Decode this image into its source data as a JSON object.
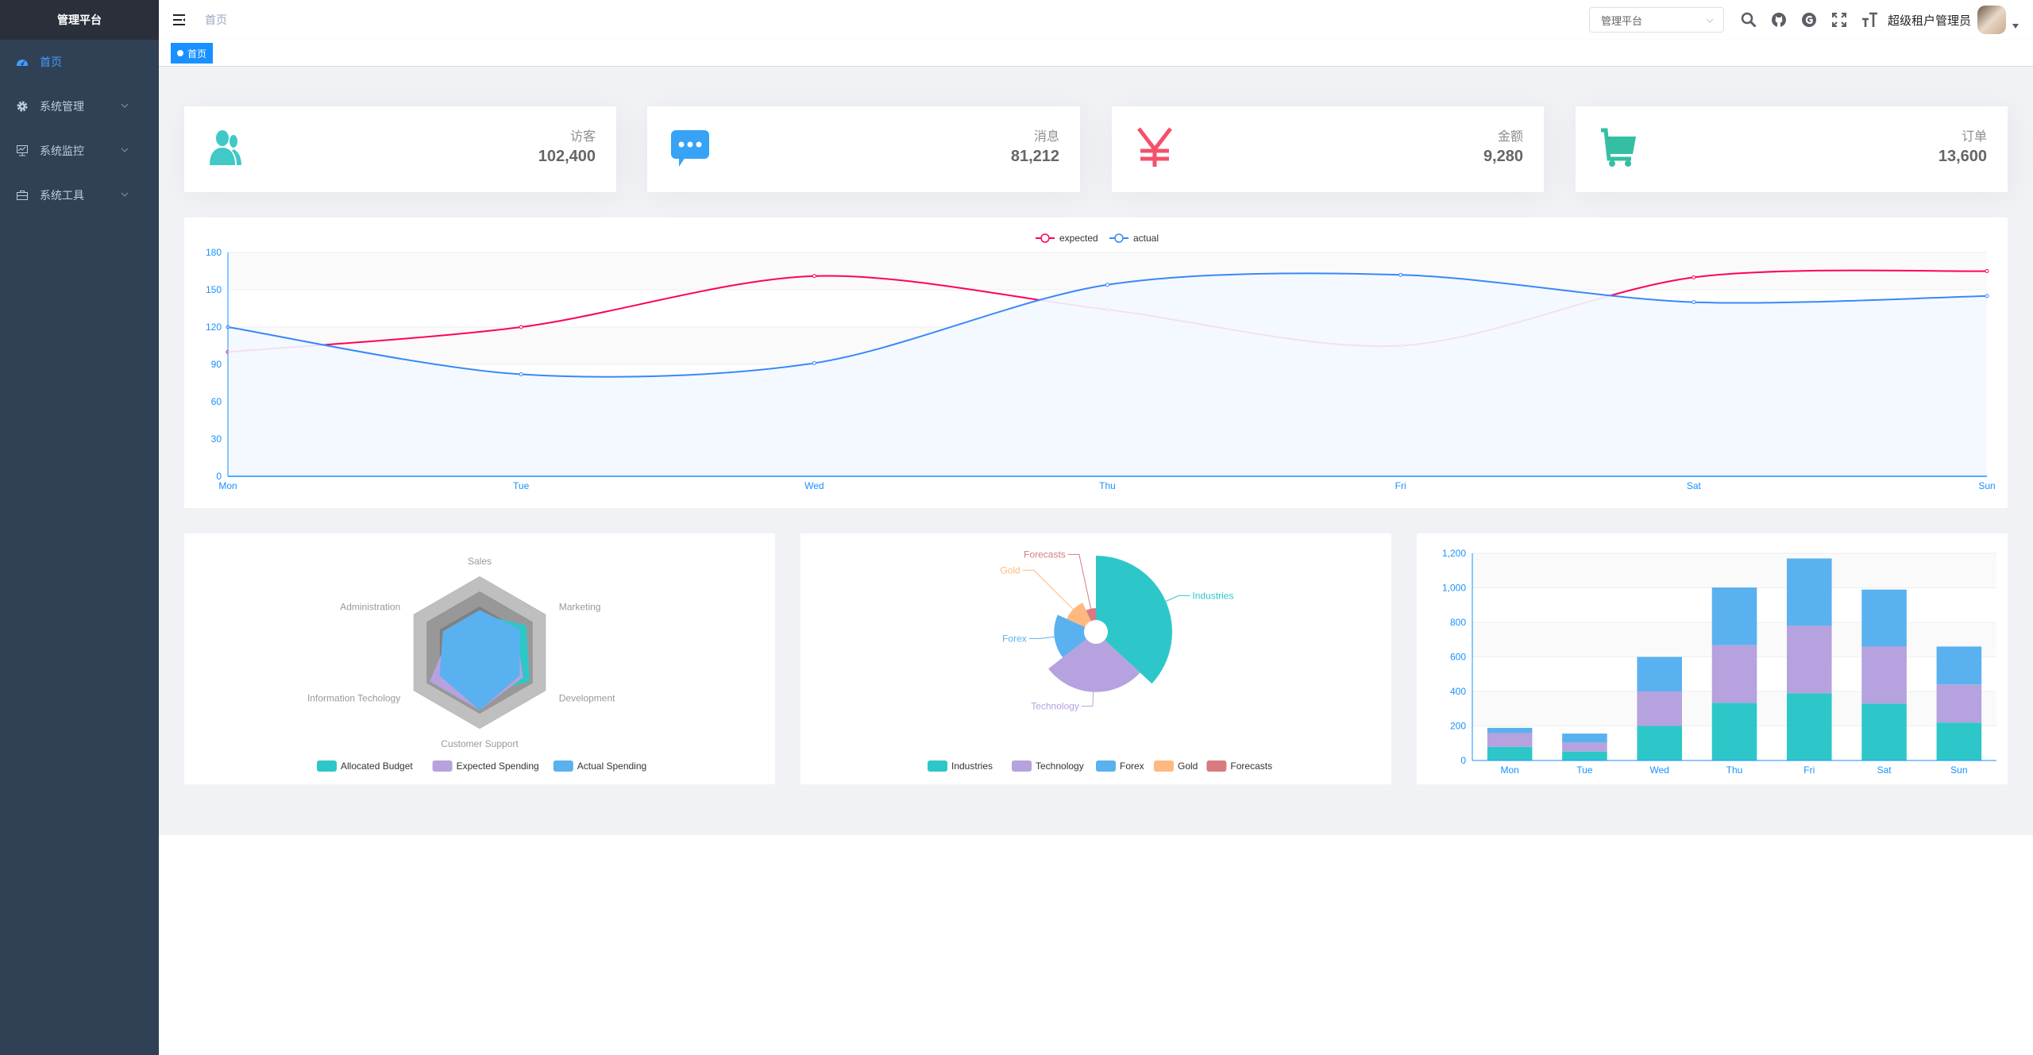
{
  "sidebar": {
    "logo": "管理平台",
    "items": [
      {
        "label": "首页",
        "icon": "dashboard-icon",
        "active": true
      },
      {
        "label": "系统管理",
        "icon": "gear-icon"
      },
      {
        "label": "系统监控",
        "icon": "monitor-icon"
      },
      {
        "label": "系统工具",
        "icon": "toolbox-icon"
      }
    ]
  },
  "navbar": {
    "breadcrumb": "首页",
    "platform_select": "管理平台",
    "username": "超级租户管理员",
    "icons": [
      "search-icon",
      "github-icon",
      "g-icon",
      "fullscreen-icon",
      "font-size-icon"
    ]
  },
  "tags": {
    "home": "首页",
    "active_color": "#1890ff"
  },
  "cards": [
    {
      "label": "访客",
      "value": "102,400",
      "icon": "peoples-icon",
      "color": "#40c9c6"
    },
    {
      "label": "消息",
      "value": "81,212",
      "icon": "message-icon",
      "color": "#36a3f7"
    },
    {
      "label": "金额",
      "value": "9,280",
      "icon": "yen-icon",
      "color": "#f4516c"
    },
    {
      "label": "订单",
      "value": "13,600",
      "icon": "shopping-cart-icon",
      "color": "#34bfa3"
    }
  ],
  "chart_data": [
    {
      "type": "line",
      "categories": [
        "Mon",
        "Tue",
        "Wed",
        "Thu",
        "Fri",
        "Sat",
        "Sun"
      ],
      "ylim": [
        0,
        180
      ],
      "yticks": [
        0,
        30,
        60,
        90,
        120,
        150,
        180
      ],
      "legend": "top-center",
      "smooth": true,
      "series": [
        {
          "name": "expected",
          "values": [
            100,
            120,
            161,
            134,
            105,
            160,
            165
          ],
          "color": "#FF005A"
        },
        {
          "name": "actual",
          "values": [
            120,
            82,
            91,
            154,
            162,
            140,
            145
          ],
          "color": "#3888fa",
          "area": "#f3f8ff"
        }
      ]
    },
    {
      "type": "radar",
      "indicators": [
        {
          "name": "Sales",
          "max": 10000
        },
        {
          "name": "Administration",
          "max": 20000
        },
        {
          "name": "Information Techology",
          "max": 20000
        },
        {
          "name": "Customer Support",
          "max": 20000
        },
        {
          "name": "Development",
          "max": 20000
        },
        {
          "name": "Marketing",
          "max": 20000
        }
      ],
      "legend": "bottom",
      "series": [
        {
          "name": "Allocated Budget",
          "values": [
            5000,
            7000,
            12000,
            11000,
            15000,
            14000
          ],
          "color": "#2ec7c9"
        },
        {
          "name": "Expected Spending",
          "values": [
            4000,
            9000,
            15000,
            15000,
            13000,
            11000
          ],
          "color": "#b6a2de"
        },
        {
          "name": "Actual Spending",
          "values": [
            5500,
            11000,
            12000,
            15000,
            12000,
            12000
          ],
          "color": "#5ab1ef"
        }
      ]
    },
    {
      "type": "pie",
      "rose": "radius",
      "legend": "bottom",
      "slices": [
        {
          "name": "Industries",
          "value": 320,
          "color": "#2ec7c9"
        },
        {
          "name": "Technology",
          "value": 240,
          "color": "#b6a2de"
        },
        {
          "name": "Forex",
          "value": 149,
          "color": "#5ab1ef"
        },
        {
          "name": "Gold",
          "value": 100,
          "color": "#ffb980"
        },
        {
          "name": "Forecasts",
          "value": 59,
          "color": "#d87a80"
        }
      ]
    },
    {
      "type": "bar",
      "stacked": true,
      "categories": [
        "Mon",
        "Tue",
        "Wed",
        "Thu",
        "Fri",
        "Sat",
        "Sun"
      ],
      "ylim": [
        0,
        1200
      ],
      "yticks": [
        0,
        200,
        400,
        600,
        800,
        1000,
        1200
      ],
      "ytick_labels": [
        "0",
        "200",
        "400",
        "600",
        "800",
        "1,000",
        "1,200"
      ],
      "series": [
        {
          "values": [
            79,
            52,
            200,
            334,
            390,
            330,
            220
          ],
          "color": "#2ec7c9"
        },
        {
          "values": [
            80,
            52,
            200,
            334,
            390,
            330,
            220
          ],
          "color": "#b6a2de"
        },
        {
          "values": [
            30,
            52,
            200,
            334,
            390,
            330,
            220
          ],
          "color": "#5ab1ef"
        }
      ]
    }
  ]
}
